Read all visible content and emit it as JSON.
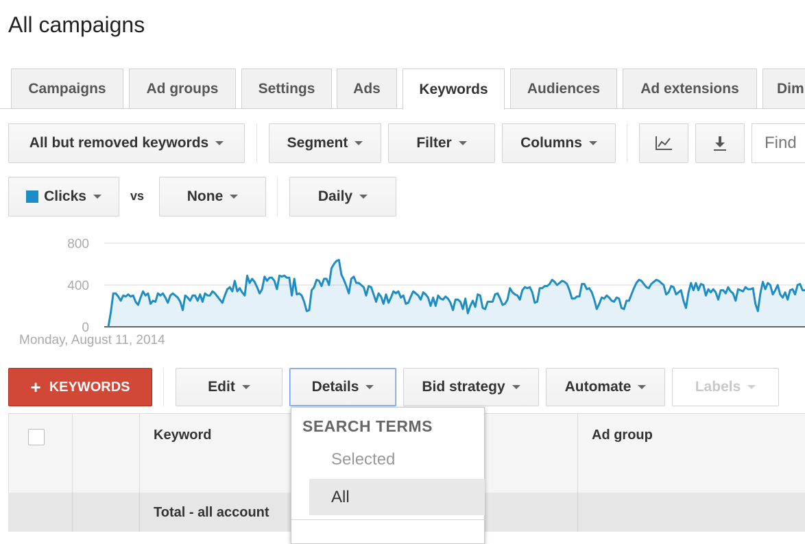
{
  "page": {
    "title": "All campaigns"
  },
  "tabs": [
    {
      "label": "Campaigns",
      "active": false
    },
    {
      "label": "Ad groups",
      "active": false
    },
    {
      "label": "Settings",
      "active": false
    },
    {
      "label": "Ads",
      "active": false
    },
    {
      "label": "Keywords",
      "active": true
    },
    {
      "label": "Audiences",
      "active": false
    },
    {
      "label": "Ad extensions",
      "active": false
    },
    {
      "label": "Dim",
      "active": false
    }
  ],
  "toolbar": {
    "status_filter": "All but removed keywords",
    "segment": "Segment",
    "filter": "Filter",
    "columns": "Columns",
    "graph_icon": "line-graph-icon",
    "download_icon": "download-icon",
    "find_placeholder": "Find"
  },
  "metrics": {
    "metric1": "Clicks",
    "metric1_color": "#1f8dc5",
    "vs": "vs",
    "metric2": "None",
    "interval": "Daily"
  },
  "chart_data": {
    "type": "area",
    "y_ticks": [
      "800",
      "400",
      "0"
    ],
    "ylim": [
      0,
      800
    ],
    "date_label": "Monday, August 11, 2014",
    "series": [
      {
        "color": "#1f8dc5",
        "values": [
          0,
          140,
          320,
          320,
          290,
          250,
          300,
          290,
          310,
          290,
          300,
          240,
          210,
          280,
          340,
          300,
          320,
          220,
          250,
          240,
          320,
          300,
          320,
          280,
          230,
          300,
          320,
          300,
          280,
          240,
          160,
          300,
          280,
          250,
          300,
          300,
          250,
          310,
          240,
          320,
          300,
          300,
          340,
          320,
          290,
          260,
          230,
          300,
          360,
          380,
          340,
          440,
          340,
          370,
          330,
          300,
          490,
          420,
          460,
          430,
          380,
          320,
          360,
          480,
          440,
          470,
          470,
          440,
          360,
          490,
          480,
          490,
          470,
          470,
          300,
          460,
          310,
          320,
          300,
          240,
          150,
          160,
          350,
          380,
          450,
          440,
          390,
          460,
          460,
          400,
          560,
          600,
          630,
          640,
          500,
          450,
          390,
          320,
          460,
          480,
          420,
          420,
          400,
          380,
          300,
          390,
          380,
          310,
          240,
          320,
          290,
          220,
          310,
          230,
          280,
          340,
          320,
          340,
          280,
          300,
          220,
          230,
          290,
          340,
          320,
          300,
          260,
          330,
          310,
          280,
          200,
          280,
          200,
          300,
          270,
          260,
          290,
          270,
          230,
          160,
          260,
          260,
          240,
          170,
          270,
          130,
          200,
          250,
          190,
          310,
          300,
          180,
          170,
          240,
          240,
          240,
          310,
          320,
          270,
          210,
          220,
          260,
          370,
          330,
          310,
          300,
          260,
          350,
          380,
          370,
          380,
          330,
          230,
          240,
          370,
          370,
          390,
          390,
          410,
          450,
          430,
          400,
          420,
          440,
          430,
          410,
          350,
          270,
          270,
          290,
          290,
          410,
          410,
          360,
          370,
          330,
          260,
          170,
          220,
          280,
          270,
          300,
          280,
          250,
          240,
          280,
          270,
          180,
          170,
          250,
          250,
          310,
          370,
          420,
          450,
          440,
          410,
          380,
          370,
          410,
          430,
          450,
          440,
          420,
          400,
          310,
          330,
          390,
          380,
          310,
          330,
          350,
          250,
          180,
          330,
          420,
          350,
          420,
          350,
          410,
          400,
          300,
          360,
          330,
          360,
          330,
          260,
          350,
          350,
          320,
          380,
          340,
          320,
          250,
          360,
          350,
          340,
          380,
          360,
          360,
          370,
          220,
          150,
          320,
          430,
          360,
          420,
          400,
          310,
          350,
          400,
          310,
          280,
          330,
          260,
          350,
          360,
          310,
          400,
          410,
          350,
          350
        ]
      }
    ]
  },
  "actions": {
    "add_keywords": "KEYWORDS",
    "edit": "Edit",
    "details": "Details",
    "bid_strategy": "Bid strategy",
    "automate": "Automate",
    "labels": "Labels"
  },
  "details_menu": {
    "section_header": "SEARCH TERMS",
    "items": [
      "Selected",
      "All"
    ]
  },
  "table": {
    "columns": {
      "keyword": "Keyword",
      "ad_group": "Ad group"
    },
    "total_row_label": "Total - all account"
  }
}
